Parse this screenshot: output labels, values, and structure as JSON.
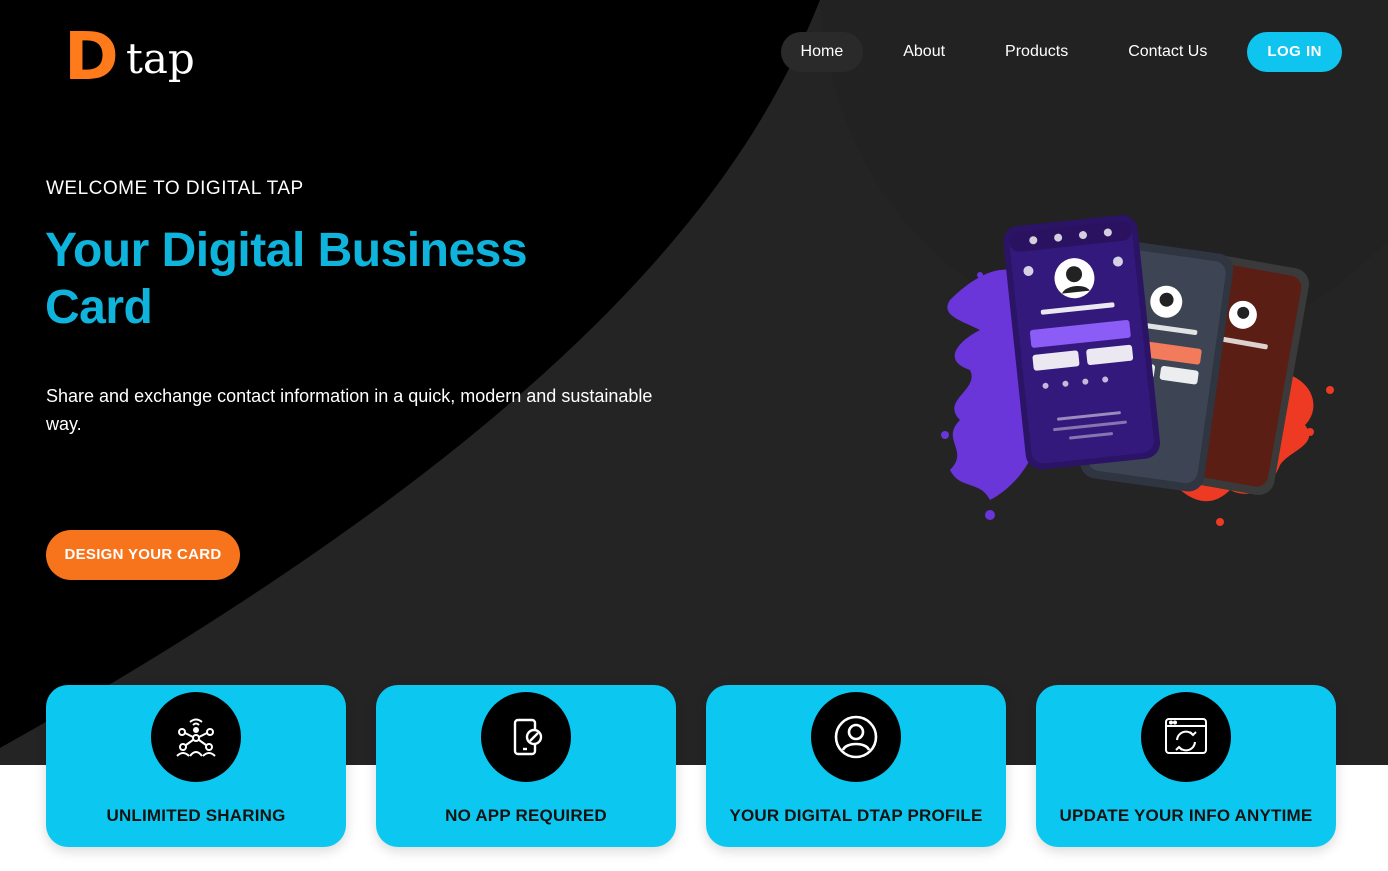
{
  "brand": {
    "logo_letter": "D",
    "logo_word": "tap",
    "accent": "#0fc4ef",
    "orange": "#f7741c"
  },
  "nav": {
    "items": [
      {
        "label": "Home",
        "active": true
      },
      {
        "label": "About",
        "active": false
      },
      {
        "label": "Products",
        "active": false
      },
      {
        "label": "Contact Us",
        "active": false
      }
    ],
    "login_label": "LOG IN"
  },
  "hero": {
    "eyebrow": "WELCOME TO DIGITAL TAP",
    "headline": "Your Digital Business Card",
    "subtext": "Share and exchange contact information in a quick, modern and sustainable way.",
    "cta_label": "DESIGN YOUR CARD"
  },
  "features": [
    {
      "title": "UNLIMITED SHARING",
      "icon": "network-sharing-icon"
    },
    {
      "title": "NO APP REQUIRED",
      "icon": "no-app-phone-icon"
    },
    {
      "title": "YOUR DIGITAL DTAP PROFILE",
      "icon": "user-profile-icon"
    },
    {
      "title": "UPDATE YOUR INFO ANYTIME",
      "icon": "update-browser-icon"
    }
  ]
}
